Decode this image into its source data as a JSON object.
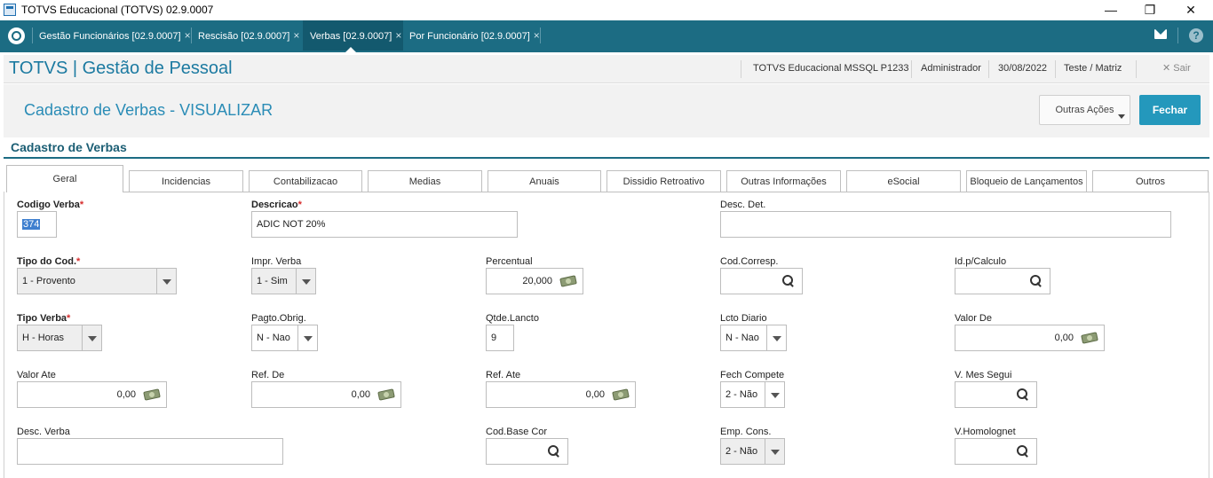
{
  "window": {
    "title": "TOTVS Educacional (TOTVS) 02.9.0007",
    "minimize": "—",
    "restore": "❐",
    "close": "✕"
  },
  "tabs": [
    {
      "label": "Gestão Funcionários [02.9.0007]",
      "close": "×"
    },
    {
      "label": "Rescisão [02.9.0007]",
      "close": "×"
    },
    {
      "label": "Verbas [02.9.0007]",
      "close": "×"
    },
    {
      "label": "Por Funcionário [02.9.0007]",
      "close": "×"
    }
  ],
  "header": {
    "app_title": "TOTVS | Gestão de Pessoal",
    "environment": "TOTVS Educacional MSSQL P1233",
    "user": "Administrador",
    "date": "30/08/2022",
    "branch": "Teste / Matriz",
    "exit_label": "✕  Sair",
    "help": "?"
  },
  "page": {
    "title": "Cadastro de Verbas - VISUALIZAR",
    "other_actions": "Outras Ações",
    "close_button": "Fechar",
    "section_title": "Cadastro de Verbas"
  },
  "form_tabs": [
    "Geral",
    "Incidencias",
    "Contabilizacao",
    "Medias",
    "Anuais",
    "Dissidio Retroativo",
    "Outras Informações",
    "eSocial",
    "Bloqueio de Lançamentos",
    "Outros"
  ],
  "fields": {
    "codigo_verba": {
      "label": "Codigo Verba",
      "value": "374"
    },
    "descricao": {
      "label": "Descricao",
      "value": "ADIC NOT 20%"
    },
    "desc_det": {
      "label": "Desc. Det.",
      "value": ""
    },
    "tipo_cod": {
      "label": "Tipo do Cod.",
      "value": "1 - Provento"
    },
    "impr_verba": {
      "label": "Impr. Verba",
      "value": "1 - Sim"
    },
    "percentual": {
      "label": "Percentual",
      "value": "20,000"
    },
    "cod_corresp": {
      "label": "Cod.Corresp.",
      "value": ""
    },
    "id_calculo": {
      "label": "Id.p/Calculo",
      "value": ""
    },
    "tipo_verba": {
      "label": "Tipo Verba",
      "value": "H - Horas"
    },
    "pagto_obrig": {
      "label": "Pagto.Obrig.",
      "value": "N - Nao"
    },
    "qtde_lancto": {
      "label": "Qtde.Lancto",
      "value": "9"
    },
    "lcto_diario": {
      "label": "Lcto Diario",
      "value": "N - Nao"
    },
    "valor_de": {
      "label": "Valor De",
      "value": "0,00"
    },
    "valor_ate": {
      "label": "Valor Ate",
      "value": "0,00"
    },
    "ref_de": {
      "label": "Ref. De",
      "value": "0,00"
    },
    "ref_ate": {
      "label": "Ref. Ate",
      "value": "0,00"
    },
    "fech_compete": {
      "label": "Fech Compete",
      "value": "2 - Não"
    },
    "v_mes_segui": {
      "label": "V. Mes Segui",
      "value": ""
    },
    "desc_verba": {
      "label": "Desc. Verba",
      "value": ""
    },
    "cod_base_cor": {
      "label": "Cod.Base Cor",
      "value": ""
    },
    "emp_cons": {
      "label": "Emp. Cons.",
      "value": "2 - Não"
    },
    "v_homolognet": {
      "label": "V.Homolognet",
      "value": ""
    }
  },
  "required_mark": "*"
}
